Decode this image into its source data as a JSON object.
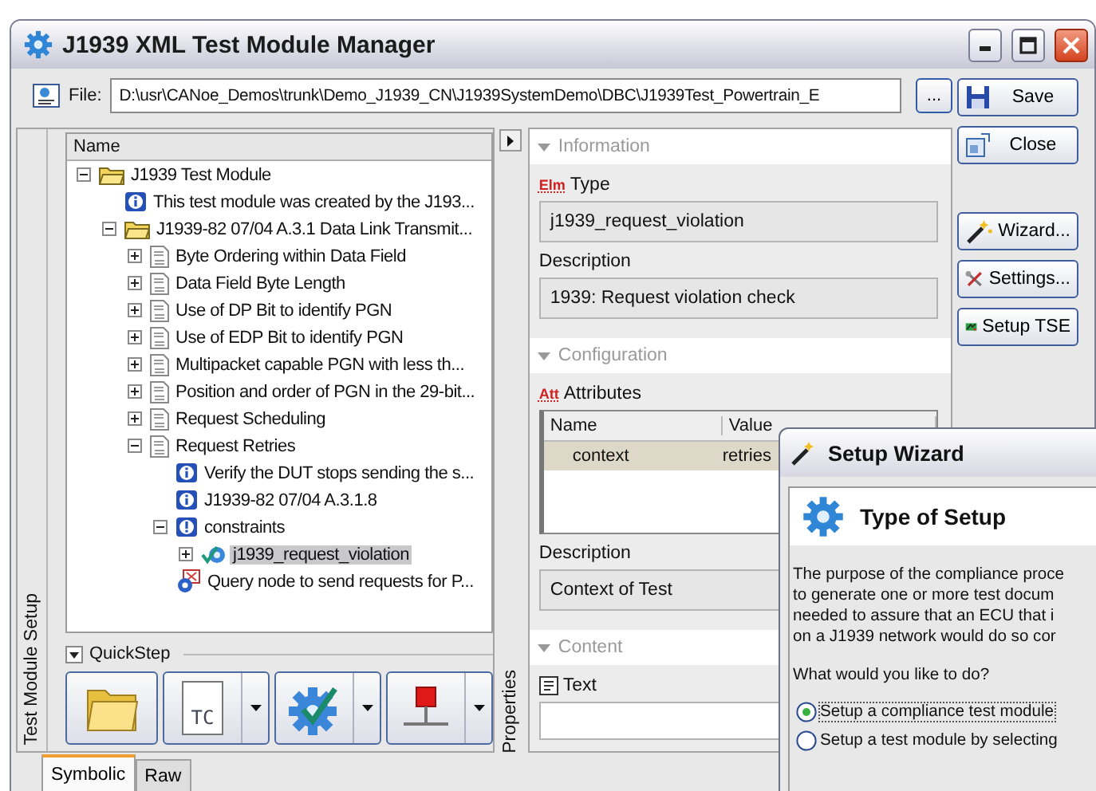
{
  "window": {
    "title": "J1939 XML Test Module Manager"
  },
  "file": {
    "label": "File:",
    "value": "D:\\usr\\CANoe_Demos\\trunk\\Demo_J1939_CN\\J1939SystemDemo\\DBC\\J1939Test_Powertrain_E",
    "browse": "..."
  },
  "side_buttons": [
    {
      "label": "Save",
      "kind": "save"
    },
    {
      "label": "Close",
      "kind": "close"
    },
    {
      "label": "Wizard...",
      "kind": "wizard"
    },
    {
      "label": "Settings...",
      "kind": "settings"
    },
    {
      "label": "Setup TSE",
      "kind": "tse"
    }
  ],
  "left_panel": {
    "tab": "Test Module Setup",
    "tree": {
      "header": "Name",
      "items": [
        {
          "kind": "folder",
          "label": "J1939 Test Module",
          "expanded": true,
          "selected": false,
          "children": [
            {
              "kind": "info",
              "label": "This test module was created by the J193...",
              "selected": false
            },
            {
              "kind": "folder",
              "label": "J1939-82 07/04 A.3.1 Data Link Transmit...",
              "expanded": true,
              "selected": false,
              "children": [
                {
                  "kind": "testcase",
                  "label": "Byte Ordering within Data Field",
                  "expanded": false,
                  "selected": false
                },
                {
                  "kind": "testcase",
                  "label": "Data Field Byte Length",
                  "expanded": false,
                  "selected": false
                },
                {
                  "kind": "testcase",
                  "label": "Use of DP Bit to identify PGN",
                  "expanded": false,
                  "selected": false
                },
                {
                  "kind": "testcase",
                  "label": "Use of EDP Bit to identify PGN",
                  "expanded": false,
                  "selected": false
                },
                {
                  "kind": "testcase",
                  "label": "Multipacket capable PGN with less th...",
                  "expanded": false,
                  "selected": false
                },
                {
                  "kind": "testcase",
                  "label": "Position and order of PGN in the 29-bit...",
                  "expanded": false,
                  "selected": false
                },
                {
                  "kind": "testcase",
                  "label": "Request Scheduling",
                  "expanded": false,
                  "selected": false
                },
                {
                  "kind": "testcase",
                  "label": "Request Retries",
                  "expanded": true,
                  "selected": false,
                  "children": [
                    {
                      "kind": "info",
                      "label": "Verify the DUT stops sending the s...",
                      "selected": false
                    },
                    {
                      "kind": "info",
                      "label": "J1939-82 07/04 A.3.1.8",
                      "selected": false
                    },
                    {
                      "kind": "constraint",
                      "label": "constraints",
                      "expanded": true,
                      "selected": false,
                      "children": [
                        {
                          "kind": "check",
                          "label": "j1939_request_violation",
                          "expanded": false,
                          "selected": true
                        }
                      ]
                    },
                    {
                      "kind": "query",
                      "label": "Query node to send requests for P...",
                      "selected": false
                    }
                  ]
                }
              ]
            }
          ]
        }
      ]
    },
    "quickstep": {
      "title": "QuickStep",
      "buttons": [
        {
          "kind": "folder",
          "dropdown": false
        },
        {
          "kind": "testcase",
          "label": "TC",
          "dropdown": true
        },
        {
          "kind": "check",
          "dropdown": true
        },
        {
          "kind": "node",
          "dropdown": true
        }
      ]
    }
  },
  "properties_tab": "Properties",
  "properties": {
    "information": {
      "title": "Information",
      "expanded": true,
      "type": {
        "badge": "Elm",
        "label": "Type",
        "value": "j1939_request_violation"
      },
      "description": {
        "label": "Description",
        "value": "1939: Request violation check"
      }
    },
    "configuration": {
      "title": "Configuration",
      "expanded": true,
      "attributes": {
        "badge": "Att",
        "label": "Attributes",
        "columns": [
          "Name",
          "Value"
        ],
        "rows": [
          {
            "cells": [
              "context",
              "retries"
            ],
            "selected": true
          }
        ]
      },
      "description": {
        "label": "Description",
        "value": "Context of Test"
      }
    },
    "content": {
      "title": "Content",
      "expanded": true,
      "text": {
        "label": "Text"
      }
    }
  },
  "bottom_tabs": [
    {
      "label": "Symbolic",
      "selected": true
    },
    {
      "label": "Raw",
      "selected": false
    }
  ],
  "wizard": {
    "title": "Setup Wizard",
    "heading": "Type of Setup",
    "intro_lines": [
      "The purpose of the compliance proce",
      "to generate one or more test docum",
      "needed to assure that an ECU that i",
      "on a J1939 network would do so cor"
    ],
    "question": "What would you like to do?",
    "options": [
      {
        "label": "Setup a compliance test module",
        "selected": true
      },
      {
        "label": "Setup a test module by selecting",
        "selected": false
      }
    ]
  }
}
